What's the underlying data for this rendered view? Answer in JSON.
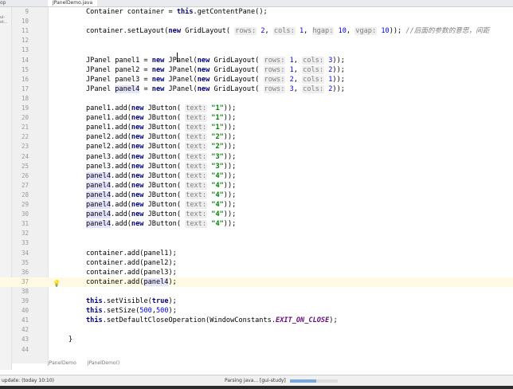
{
  "top": {
    "left_label": "op",
    "tab_label": "JPanelDemo.java"
  },
  "side": {
    "text": "ui-st..."
  },
  "lines": [
    {
      "num": "9",
      "segs": [
        {
          "t": "Container container = "
        },
        {
          "t": "this",
          "c": "kw"
        },
        {
          "t": ".getContentPane();"
        }
      ]
    },
    {
      "num": "10",
      "segs": []
    },
    {
      "num": "11",
      "segs": [
        {
          "t": "container.setLayout("
        },
        {
          "t": "new",
          "c": "kw"
        },
        {
          "t": " GridLayout( "
        },
        {
          "t": "rows:",
          "c": "hint"
        },
        {
          "t": " "
        },
        {
          "t": "2",
          "c": "num"
        },
        {
          "t": ", "
        },
        {
          "t": "cols:",
          "c": "hint"
        },
        {
          "t": " "
        },
        {
          "t": "1",
          "c": "num"
        },
        {
          "t": ", "
        },
        {
          "t": "hgap:",
          "c": "hint"
        },
        {
          "t": " "
        },
        {
          "t": "10",
          "c": "num"
        },
        {
          "t": ", "
        },
        {
          "t": "vgap:",
          "c": "hint"
        },
        {
          "t": " "
        },
        {
          "t": "10",
          "c": "num"
        },
        {
          "t": ")); "
        },
        {
          "t": "//后面的参数的意思，间距",
          "c": "cmt"
        }
      ]
    },
    {
      "num": "12",
      "segs": []
    },
    {
      "num": "13",
      "segs": []
    },
    {
      "num": "14",
      "segs": [
        {
          "t": "JPanel panel1 = "
        },
        {
          "t": "new",
          "c": "kw"
        },
        {
          "t": " JPanel("
        },
        {
          "t": "new",
          "c": "kw"
        },
        {
          "t": " GridLayout( "
        },
        {
          "t": "rows:",
          "c": "hint"
        },
        {
          "t": " "
        },
        {
          "t": "1",
          "c": "num"
        },
        {
          "t": ", "
        },
        {
          "t": "cols:",
          "c": "hint"
        },
        {
          "t": " "
        },
        {
          "t": "3",
          "c": "num"
        },
        {
          "t": "));"
        }
      ]
    },
    {
      "num": "15",
      "segs": [
        {
          "t": "JPanel panel2 = "
        },
        {
          "t": "new",
          "c": "kw"
        },
        {
          "t": " JPanel("
        },
        {
          "t": "new",
          "c": "kw"
        },
        {
          "t": " GridLayout( "
        },
        {
          "t": "rows:",
          "c": "hint"
        },
        {
          "t": " "
        },
        {
          "t": "1",
          "c": "num"
        },
        {
          "t": ", "
        },
        {
          "t": "cols:",
          "c": "hint"
        },
        {
          "t": " "
        },
        {
          "t": "2",
          "c": "num"
        },
        {
          "t": "));"
        }
      ]
    },
    {
      "num": "16",
      "segs": [
        {
          "t": "JPanel panel3 = "
        },
        {
          "t": "new",
          "c": "kw"
        },
        {
          "t": " JPanel("
        },
        {
          "t": "new",
          "c": "kw"
        },
        {
          "t": " GridLayout( "
        },
        {
          "t": "rows:",
          "c": "hint"
        },
        {
          "t": " "
        },
        {
          "t": "2",
          "c": "num"
        },
        {
          "t": ", "
        },
        {
          "t": "cols:",
          "c": "hint"
        },
        {
          "t": " "
        },
        {
          "t": "1",
          "c": "num"
        },
        {
          "t": "));"
        }
      ]
    },
    {
      "num": "17",
      "segs": [
        {
          "t": "JPanel "
        },
        {
          "t": "panel4",
          "c": "ref"
        },
        {
          "t": " = "
        },
        {
          "t": "new",
          "c": "kw"
        },
        {
          "t": " JPanel("
        },
        {
          "t": "new",
          "c": "kw"
        },
        {
          "t": " GridLayout( "
        },
        {
          "t": "rows:",
          "c": "hint"
        },
        {
          "t": " "
        },
        {
          "t": "3",
          "c": "num"
        },
        {
          "t": ", "
        },
        {
          "t": "cols:",
          "c": "hint"
        },
        {
          "t": " "
        },
        {
          "t": "2",
          "c": "num"
        },
        {
          "t": "));"
        }
      ]
    },
    {
      "num": "18",
      "segs": []
    },
    {
      "num": "19",
      "segs": [
        {
          "t": "panel1.add("
        },
        {
          "t": "new",
          "c": "kw"
        },
        {
          "t": " JButton( "
        },
        {
          "t": "text:",
          "c": "hint"
        },
        {
          "t": " "
        },
        {
          "t": "\"1\"",
          "c": "str"
        },
        {
          "t": "));"
        }
      ]
    },
    {
      "num": "20",
      "segs": [
        {
          "t": "panel1.add("
        },
        {
          "t": "new",
          "c": "kw"
        },
        {
          "t": " JButton( "
        },
        {
          "t": "text:",
          "c": "hint"
        },
        {
          "t": " "
        },
        {
          "t": "\"1\"",
          "c": "str"
        },
        {
          "t": "));"
        }
      ]
    },
    {
      "num": "21",
      "segs": [
        {
          "t": "panel1.add("
        },
        {
          "t": "new",
          "c": "kw"
        },
        {
          "t": " JButton( "
        },
        {
          "t": "text:",
          "c": "hint"
        },
        {
          "t": " "
        },
        {
          "t": "\"1\"",
          "c": "str"
        },
        {
          "t": "));"
        }
      ]
    },
    {
      "num": "22",
      "segs": [
        {
          "t": "panel2.add("
        },
        {
          "t": "new",
          "c": "kw"
        },
        {
          "t": " JButton( "
        },
        {
          "t": "text:",
          "c": "hint"
        },
        {
          "t": " "
        },
        {
          "t": "\"2\"",
          "c": "str"
        },
        {
          "t": "));"
        }
      ]
    },
    {
      "num": "23",
      "segs": [
        {
          "t": "panel2.add("
        },
        {
          "t": "new",
          "c": "kw"
        },
        {
          "t": " JButton( "
        },
        {
          "t": "text:",
          "c": "hint"
        },
        {
          "t": " "
        },
        {
          "t": "\"2\"",
          "c": "str"
        },
        {
          "t": "));"
        }
      ]
    },
    {
      "num": "24",
      "segs": [
        {
          "t": "panel3.add("
        },
        {
          "t": "new",
          "c": "kw"
        },
        {
          "t": " JButton( "
        },
        {
          "t": "text:",
          "c": "hint"
        },
        {
          "t": " "
        },
        {
          "t": "\"3\"",
          "c": "str"
        },
        {
          "t": "));"
        }
      ]
    },
    {
      "num": "25",
      "segs": [
        {
          "t": "panel3.add("
        },
        {
          "t": "new",
          "c": "kw"
        },
        {
          "t": " JButton( "
        },
        {
          "t": "text:",
          "c": "hint"
        },
        {
          "t": " "
        },
        {
          "t": "\"3\"",
          "c": "str"
        },
        {
          "t": "));"
        }
      ]
    },
    {
      "num": "26",
      "segs": [
        {
          "t": "panel4",
          "c": "ref"
        },
        {
          "t": ".add("
        },
        {
          "t": "new",
          "c": "kw"
        },
        {
          "t": " JButton( "
        },
        {
          "t": "text:",
          "c": "hint"
        },
        {
          "t": " "
        },
        {
          "t": "\"4\"",
          "c": "str"
        },
        {
          "t": "));"
        }
      ]
    },
    {
      "num": "27",
      "segs": [
        {
          "t": "panel4",
          "c": "ref"
        },
        {
          "t": ".add("
        },
        {
          "t": "new",
          "c": "kw"
        },
        {
          "t": " JButton( "
        },
        {
          "t": "text:",
          "c": "hint"
        },
        {
          "t": " "
        },
        {
          "t": "\"4\"",
          "c": "str"
        },
        {
          "t": "));"
        }
      ]
    },
    {
      "num": "28",
      "segs": [
        {
          "t": "panel4",
          "c": "ref"
        },
        {
          "t": ".add("
        },
        {
          "t": "new",
          "c": "kw"
        },
        {
          "t": " JButton( "
        },
        {
          "t": "text:",
          "c": "hint"
        },
        {
          "t": " "
        },
        {
          "t": "\"4\"",
          "c": "str"
        },
        {
          "t": "));"
        }
      ]
    },
    {
      "num": "29",
      "segs": [
        {
          "t": "panel4",
          "c": "ref"
        },
        {
          "t": ".add("
        },
        {
          "t": "new",
          "c": "kw"
        },
        {
          "t": " JButton( "
        },
        {
          "t": "text:",
          "c": "hint"
        },
        {
          "t": " "
        },
        {
          "t": "\"4\"",
          "c": "str"
        },
        {
          "t": "));"
        }
      ]
    },
    {
      "num": "30",
      "segs": [
        {
          "t": "panel4",
          "c": "ref"
        },
        {
          "t": ".add("
        },
        {
          "t": "new",
          "c": "kw"
        },
        {
          "t": " JButton( "
        },
        {
          "t": "text:",
          "c": "hint"
        },
        {
          "t": " "
        },
        {
          "t": "\"4\"",
          "c": "str"
        },
        {
          "t": "));"
        }
      ]
    },
    {
      "num": "31",
      "segs": [
        {
          "t": "panel4",
          "c": "ref"
        },
        {
          "t": ".add("
        },
        {
          "t": "new",
          "c": "kw"
        },
        {
          "t": " JButton( "
        },
        {
          "t": "text:",
          "c": "hint"
        },
        {
          "t": " "
        },
        {
          "t": "\"4\"",
          "c": "str"
        },
        {
          "t": "));"
        }
      ]
    },
    {
      "num": "32",
      "segs": []
    },
    {
      "num": "33",
      "segs": []
    },
    {
      "num": "34",
      "segs": [
        {
          "t": "container.add(panel1);"
        }
      ]
    },
    {
      "num": "35",
      "segs": [
        {
          "t": "container.add(panel2);"
        }
      ]
    },
    {
      "num": "36",
      "segs": [
        {
          "t": "container.add(panel3);"
        }
      ]
    },
    {
      "num": "37",
      "segs": [
        {
          "t": "container.add("
        },
        {
          "t": "panel4",
          "c": "ref"
        },
        {
          "t": ");"
        }
      ],
      "hl": true,
      "bulb": true
    },
    {
      "num": "38",
      "segs": []
    },
    {
      "num": "39",
      "segs": [
        {
          "t": "this",
          "c": "kw"
        },
        {
          "t": ".setVisible("
        },
        {
          "t": "true",
          "c": "kw"
        },
        {
          "t": ");"
        }
      ]
    },
    {
      "num": "40",
      "segs": [
        {
          "t": "this",
          "c": "kw"
        },
        {
          "t": ".setSize("
        },
        {
          "t": "500",
          "c": "num"
        },
        {
          "t": ","
        },
        {
          "t": "500",
          "c": "num"
        },
        {
          "t": ");"
        }
      ]
    },
    {
      "num": "41",
      "segs": [
        {
          "t": "this",
          "c": "kw"
        },
        {
          "t": ".setDefaultCloseOperation(WindowConstants."
        },
        {
          "t": "EXIT_ON_CLOSE",
          "c": "cst"
        },
        {
          "t": ");"
        }
      ]
    },
    {
      "num": "42",
      "segs": []
    },
    {
      "num": "43",
      "segs": [
        {
          "t": "}",
          "indent": "back"
        }
      ]
    },
    {
      "num": "44",
      "segs": []
    }
  ],
  "breadcrumb": [
    "JPanelDemo",
    "JPanelDemo()"
  ],
  "status": {
    "left": "update: (today 10:10)",
    "middle": "Parsing java... [gui-study]",
    "progress": 0.55
  }
}
